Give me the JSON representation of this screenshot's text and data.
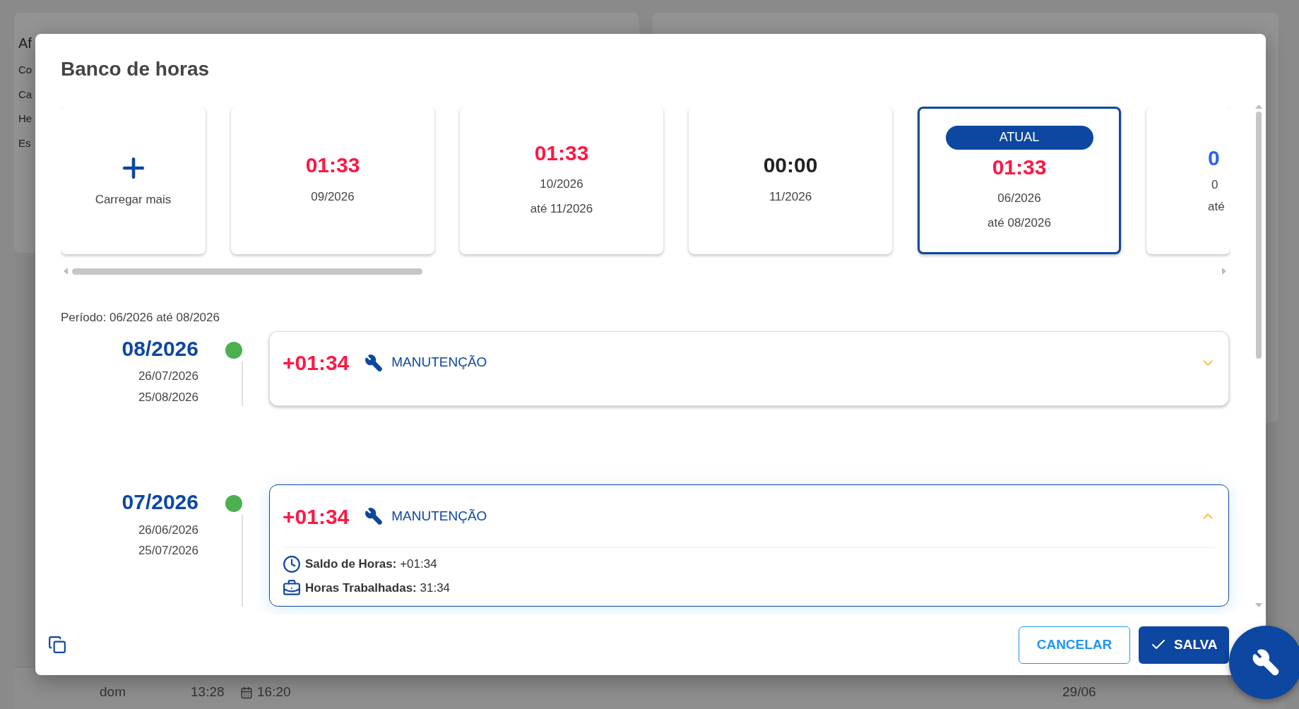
{
  "background": {
    "labels": [
      "Af",
      "Co",
      "Ca",
      "He",
      "Es"
    ],
    "row": {
      "day": "dom",
      "start": "13:28",
      "end": "16:20",
      "date": "29/06"
    }
  },
  "dialog": {
    "title": "Banco de horas",
    "load_more": "Carregar mais",
    "periods": [
      {
        "kind": "full",
        "balance": "01:33",
        "color": "#ff1744",
        "lines": [
          "09/2026"
        ],
        "selected": false
      },
      {
        "kind": "full",
        "balance": "01:33",
        "color": "#ff1744",
        "lines": [
          "10/2026",
          "até 11/2026"
        ],
        "selected": false
      },
      {
        "kind": "full",
        "balance": "00:00",
        "color": "#222222",
        "lines": [
          "11/2026"
        ],
        "selected": false
      },
      {
        "kind": "full",
        "badge": "ATUAL",
        "balance": "01:33",
        "color": "#ff1744",
        "lines": [
          "06/2026",
          "até 08/2026"
        ],
        "selected": true
      },
      {
        "kind": "partial",
        "balance": "0",
        "color": "#2962ff",
        "lines": [
          "0",
          "até"
        ],
        "selected": false
      }
    ],
    "period_label": "Período: 06/2026 até 08/2026",
    "entries": [
      {
        "month": "08/2026",
        "start": "26/07/2026",
        "end": "25/08/2026",
        "color": "#4caf50",
        "balance": "+01:34",
        "category": "MANUTENÇÃO",
        "expanded": false
      },
      {
        "month": "07/2026",
        "start": "26/06/2026",
        "end": "25/07/2026",
        "color": "#4caf50",
        "balance": "+01:34",
        "category": "MANUTENÇÃO",
        "expanded": true,
        "details": [
          {
            "kind": "clock",
            "label": "Saldo de Horas:",
            "value": "+01:34"
          },
          {
            "kind": "briefcase",
            "label": "Horas Trabalhadas:",
            "value": "31:34"
          }
        ]
      }
    ],
    "cancel": "CANCELAR",
    "save": "SALVA"
  }
}
